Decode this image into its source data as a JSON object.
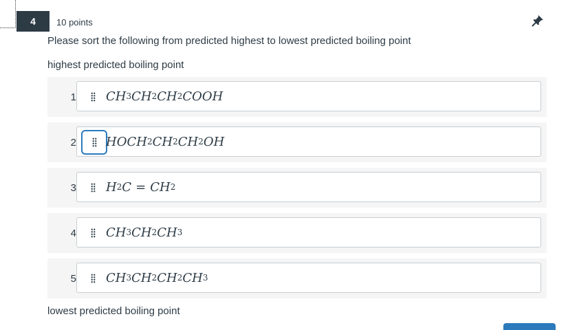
{
  "question": {
    "number": "4",
    "points": "10 points",
    "prompt": "Please sort the following from predicted highest to lowest predicted boiling point",
    "top_label": "highest predicted boiling point",
    "bottom_label": "lowest predicted boiling point"
  },
  "items": [
    {
      "rank": "1",
      "formula": "CH3CH2CH2COOH"
    },
    {
      "rank": "2",
      "formula": "HOCH2CH2CH2OH"
    },
    {
      "rank": "3",
      "formula": "H2C = CH2"
    },
    {
      "rank": "4",
      "formula": "CH3CH2CH3"
    },
    {
      "rank": "5",
      "formula": "CH3CH2CH2CH3"
    }
  ],
  "icons": {
    "pin": "pin-icon",
    "grip": "drag-handle-icon"
  },
  "colors": {
    "badge_bg": "#2d3b45",
    "focus_ring": "#2b7abc",
    "row_bg": "#f5f5f5"
  }
}
